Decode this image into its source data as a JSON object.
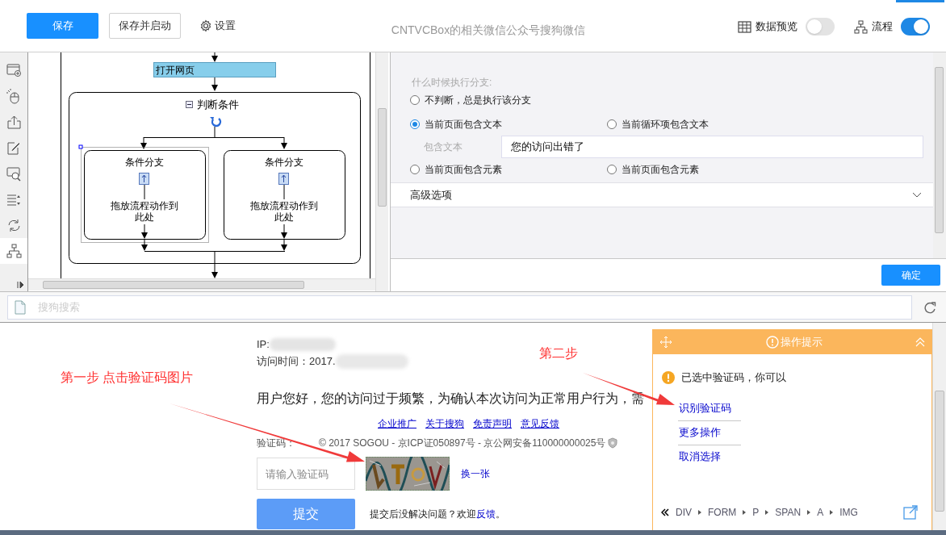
{
  "toolbar": {
    "buttons": [
      {
        "label": "保存",
        "kind": "primary"
      },
      {
        "label": "保存并启动",
        "kind": "default"
      },
      {
        "label": "设置",
        "kind": "settings"
      }
    ],
    "title": "CNTVCBox的相关微信公众号搜狗微信",
    "toggles": [
      {
        "label": "数据预览",
        "kind": "table",
        "on": false
      },
      {
        "label": "流程",
        "kind": "flow",
        "on": true
      }
    ]
  },
  "sidebar_tools": [
    {
      "kind": "window-add",
      "selected": false
    },
    {
      "kind": "mouse",
      "selected": false
    },
    {
      "kind": "export",
      "selected": false
    },
    {
      "kind": "edit",
      "selected": false
    },
    {
      "kind": "capture",
      "selected": false
    },
    {
      "kind": "list",
      "selected": false
    },
    {
      "kind": "loop",
      "selected": false
    },
    {
      "kind": "flow",
      "selected": true
    }
  ],
  "flow": {
    "start": "打开网页",
    "condition": "判断条件",
    "branches": [
      {
        "title": "条件分支",
        "hint_lines": [
          "拖放流程动作到",
          "此处"
        ],
        "selected": true
      },
      {
        "title": "条件分支",
        "hint_lines": [
          "拖放流程动作到",
          "此处"
        ],
        "selected": false
      }
    ]
  },
  "branch_settings": {
    "question": "什么时候执行分支:",
    "options": [
      {
        "label": "不判断，总是执行该分支",
        "selected": false
      },
      {
        "label": "当前页面包含文本",
        "selected": true
      },
      {
        "label": "当前循环项包含文本",
        "selected": false
      },
      {
        "label": "当前页面包含元素",
        "selected": false
      },
      {
        "label": "当前页面包含元素",
        "selected": false
      }
    ],
    "text_field": {
      "label": "包含文本",
      "value": "您的访问出错了"
    },
    "advanced": {
      "label": "高级选项",
      "expanded": false
    },
    "confirm": "确定"
  },
  "browser": {
    "address_placeholder": "搜狗搜索",
    "page": {
      "ip_label": "IP:",
      "time_label": "访问时间：2017.",
      "message": "用户您好，您的访问过于频繁，为确认本次访问为正常用户行为，需",
      "links": [
        "企业推广",
        "关于搜狗",
        "免责声明",
        "意见反馈"
      ],
      "captcha_label": "验证码：",
      "copyright": "© 2017 SOGOU - 京ICP证050897号 - 京公网安备110000000025号",
      "captcha_placeholder": "请输入验证码",
      "refresh_link": "换一张",
      "submit": "提交",
      "help": {
        "text": "提交后没解决问题？欢迎",
        "link": "反馈",
        "end": "。"
      }
    }
  },
  "tip_panel": {
    "title": "操作提示",
    "message": "已选中验证码，你可以",
    "actions": [
      "识别验证码",
      "更多操作",
      "取消选择"
    ],
    "path": [
      "DIV",
      "FORM",
      "P",
      "SPAN",
      "A",
      "IMG"
    ]
  },
  "annotations": [
    {
      "text": "第一步 点击验证码图片"
    },
    {
      "text": "第二步"
    }
  ]
}
